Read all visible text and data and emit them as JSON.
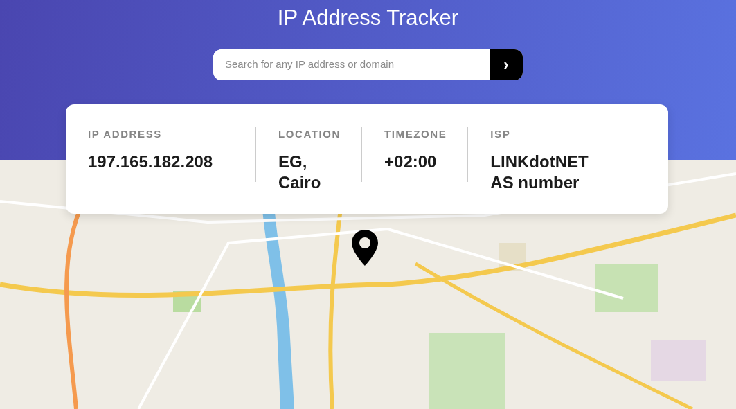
{
  "header": {
    "title": "IP Address Tracker"
  },
  "search": {
    "placeholder": "Search for any IP address or domain",
    "button": "›"
  },
  "info": [
    {
      "label": "IP ADDRESS",
      "value": "197.165.182.208"
    },
    {
      "label": "LOCATION",
      "value": "EG, Cairo"
    },
    {
      "label": "TIMEZONE",
      "value": "+02:00"
    },
    {
      "label": "ISP",
      "value": "LINKdotNET AS number"
    }
  ]
}
